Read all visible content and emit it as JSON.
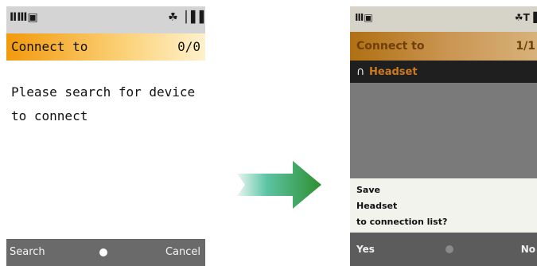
{
  "left_screen": {
    "status": {
      "left_icons": "ⅡⅢ▣",
      "right_icons": "☘▕▐▐"
    },
    "title": "Connect to",
    "count": "0/0",
    "message": [
      "Please search for device",
      "to connect"
    ],
    "softkeys": {
      "left": "Search",
      "right": "Cancel"
    }
  },
  "right_screen": {
    "status": {
      "left_icons": "Ⅲ▣",
      "right_icons": "☘T▐"
    },
    "title": "Connect to",
    "count": "1/1",
    "items": [
      {
        "icon": "headset-icon",
        "label": "Headset"
      }
    ],
    "dialog": [
      "Save",
      "Headset",
      "to connection list?"
    ],
    "softkeys": {
      "left": "Yes",
      "right": "No"
    }
  },
  "colors": {
    "title_orange": "#f29a0c",
    "arrow_teal": "#38b07a",
    "arrow_green": "#2d8f30"
  }
}
